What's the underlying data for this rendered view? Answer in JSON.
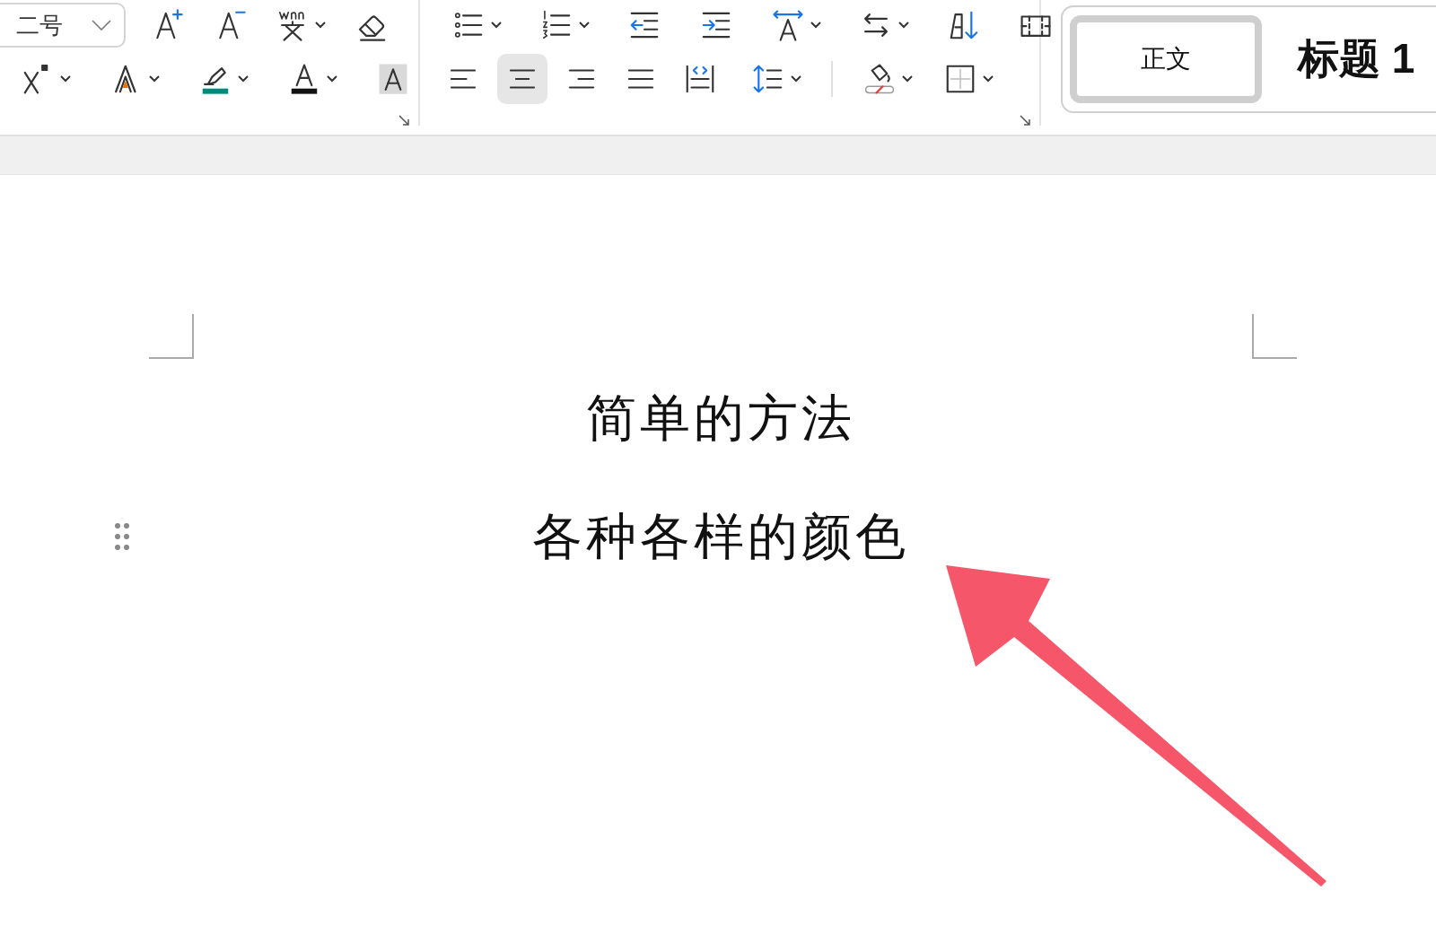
{
  "font_group": {
    "font_size": {
      "value": "二号"
    },
    "row_1": [
      {
        "kind": "grow-font",
        "dropdown": false
      },
      {
        "kind": "shrink-font",
        "dropdown": false
      },
      {
        "kind": "phonetic-guide",
        "dropdown": true
      },
      {
        "kind": "clear-format",
        "dropdown": false
      }
    ],
    "row_2": [
      {
        "kind": "superscript",
        "dropdown": true
      },
      {
        "kind": "text-effect",
        "dropdown": true
      },
      {
        "kind": "highlight",
        "dropdown": true
      },
      {
        "kind": "font-color",
        "dropdown": true
      },
      {
        "kind": "char-shading",
        "dropdown": false
      }
    ]
  },
  "paragraph_group": {
    "row_1": [
      {
        "kind": "bullets",
        "dropdown": true
      },
      {
        "kind": "numbering",
        "dropdown": true
      },
      {
        "kind": "outdent",
        "dropdown": false
      },
      {
        "kind": "indent",
        "dropdown": false
      },
      {
        "kind": "char-spacing",
        "dropdown": true
      },
      {
        "kind": "text-direction",
        "dropdown": true
      },
      {
        "kind": "sort",
        "dropdown": false
      },
      {
        "kind": "gridlines",
        "dropdown": false
      }
    ],
    "alignment": [
      {
        "kind": "align-left",
        "selected": false
      },
      {
        "kind": "align-center",
        "selected": true
      },
      {
        "kind": "align-right",
        "selected": false
      },
      {
        "kind": "justify",
        "selected": false
      },
      {
        "kind": "distributed",
        "selected": false
      }
    ],
    "row_2": [
      {
        "kind": "line-spacing",
        "dropdown": true
      },
      {
        "kind": "shading",
        "dropdown": true
      },
      {
        "kind": "borders",
        "dropdown": true
      }
    ]
  },
  "styles": [
    {
      "kind": "body",
      "label": "正文",
      "selected": true
    },
    {
      "kind": "heading",
      "label": "标题 1",
      "selected": false
    }
  ],
  "document": {
    "paragraphs": [
      "简单的方法",
      "各种各样的颜色"
    ]
  }
}
